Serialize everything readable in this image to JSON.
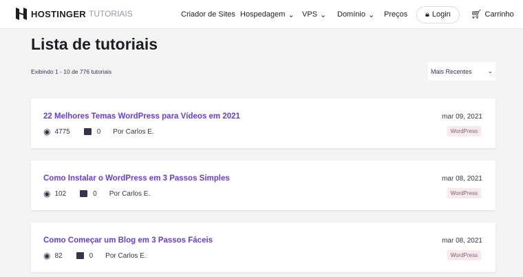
{
  "header": {
    "brand": "HOSTINGER",
    "brand_suffix": "TUTORIAIS",
    "nav": [
      "Criador de Sites",
      "Hospedagem",
      "VPS",
      "Domínio",
      "Preços"
    ],
    "login": "Login",
    "cart": "Carrinho"
  },
  "page": {
    "title": "Lista de tutoriais",
    "count": "Exibindo 1 - 10 de 776 tutoriais",
    "sort": "Mais Recentes"
  },
  "posts": [
    {
      "title": "22 Melhores Temas WordPress para Vídeos em 2021",
      "views": "4775",
      "comments": "0",
      "author": "Por Carlos E.",
      "date": "mar 09, 2021",
      "tag": "WordPress"
    },
    {
      "title": "Como Instalar o WordPress em 3 Passos Simples",
      "views": "102",
      "comments": "0",
      "author": "Por Carlos E.",
      "date": "mar 08, 2021",
      "tag": "WordPress"
    },
    {
      "title": "Como Começar um Blog em 3 Passos Fáceis",
      "views": "82",
      "comments": "0",
      "author": "Por Carlos E.",
      "date": "mar 08, 2021",
      "tag": "WordPress"
    }
  ]
}
